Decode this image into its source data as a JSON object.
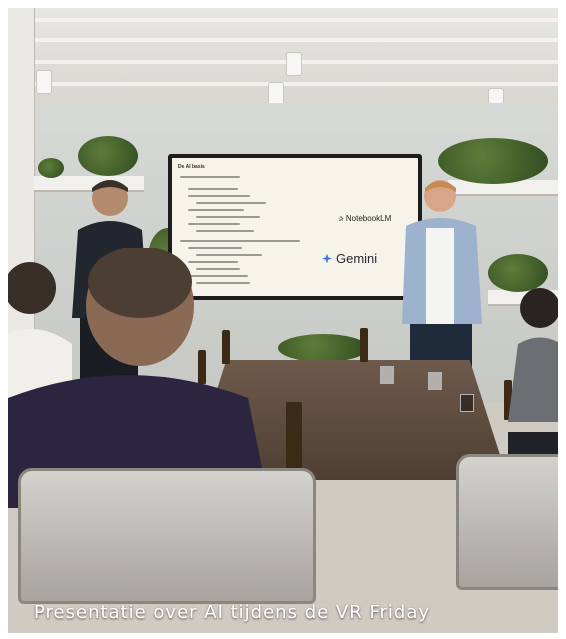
{
  "photo": {
    "caption": "Presentatie over AI tijdens de VR Friday",
    "slide": {
      "title": "De AI basis",
      "brand_one": "NotebookLM",
      "brand_two": "Gemini",
      "accent": "#3d78c8"
    }
  }
}
